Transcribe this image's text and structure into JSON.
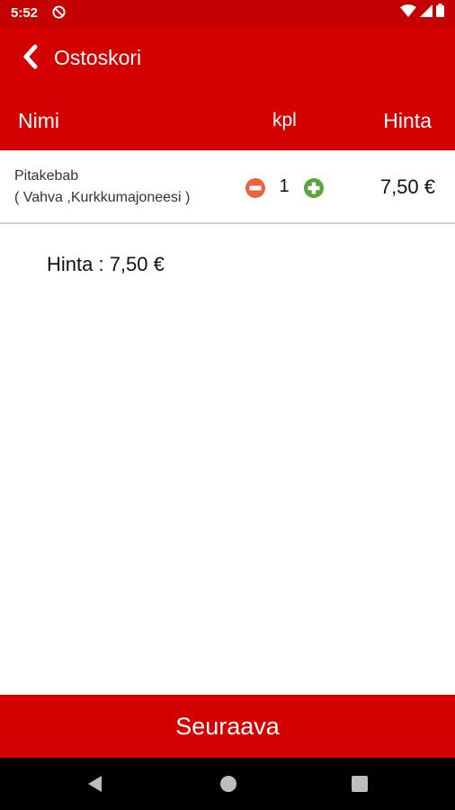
{
  "status_bar": {
    "time": "5:52",
    "icons": [
      "do-not-disturb-icon",
      "wifi-icon",
      "signal-icon",
      "battery-icon"
    ],
    "background": "#c40000"
  },
  "app_bar": {
    "title": "Ostoskori",
    "back_icon": "chevron-left-icon",
    "background": "#d40000"
  },
  "columns": {
    "name": "Nimi",
    "quantity": "kpl",
    "price": "Hinta"
  },
  "cart": {
    "items": [
      {
        "name": "Pitakebab",
        "options": "( Vahva ,Kurkkumajoneesi )",
        "quantity": "1",
        "price": "7,50 €",
        "minus_icon": "minus-circle-icon",
        "plus_icon": "plus-circle-icon"
      }
    ]
  },
  "total": {
    "text": "Hinta : 7,50 €"
  },
  "next_button": {
    "label": "Seuraava"
  },
  "colors": {
    "brand_red": "#d40000",
    "minus_orange": "#e8643c",
    "plus_green": "#5aa437"
  }
}
